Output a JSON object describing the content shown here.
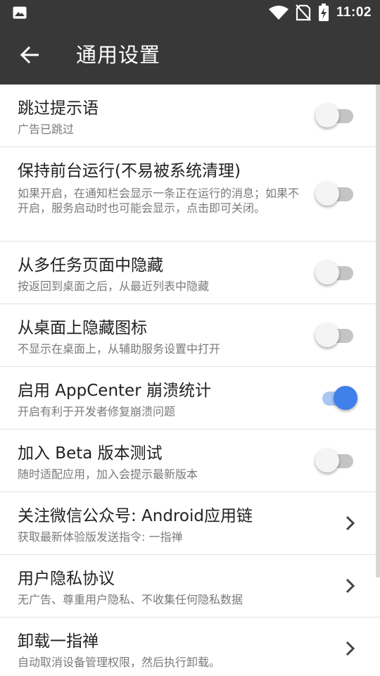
{
  "status_bar": {
    "time": "11:02",
    "icons": [
      "image-notification-icon",
      "wifi-icon",
      "no-sim-icon",
      "battery-charging-icon"
    ]
  },
  "app_bar": {
    "title": "通用设置",
    "back_icon": "arrow-left-icon"
  },
  "colors": {
    "app_bar_bg": "#383838",
    "switch_on": "#3f80ea",
    "switch_on_track": "#a9c6f4",
    "switch_off_track": "#c4c4c4"
  },
  "settings": [
    {
      "title": "跳过提示语",
      "subtitle": "广告已跳过",
      "control": "switch",
      "on": false
    },
    {
      "title": "保持前台运行(不易被系统清理)",
      "subtitle": "如果开启，在通知栏会显示一条正在运行的消息；如果不开启，服务启动时也可能会显示，点击即可关闭。",
      "control": "switch",
      "on": false
    },
    {
      "title": "从多任务页面中隐藏",
      "subtitle": "按返回到桌面之后，从最近列表中隐藏",
      "control": "switch",
      "on": false
    },
    {
      "title": "从桌面上隐藏图标",
      "subtitle": "不显示在桌面上，从辅助服务设置中打开",
      "control": "switch",
      "on": false
    },
    {
      "title": "启用 AppCenter 崩溃统计",
      "subtitle": "开启有利于开发者修复崩溃问题",
      "control": "switch",
      "on": true
    },
    {
      "title": "加入 Beta 版本测试",
      "subtitle": "随时适配应用，加入会提示最新版本",
      "control": "switch",
      "on": false
    },
    {
      "title": "关注微信公众号: Android应用链",
      "subtitle": "获取最新体验版发送指令: 一指禅",
      "control": "chevron"
    },
    {
      "title": "用户隐私协议",
      "subtitle": "无广告、尊重用户隐私、不收集任何隐私数据",
      "control": "chevron"
    },
    {
      "title": "卸载一指禅",
      "subtitle": "自动取消设备管理权限，然后执行卸载。",
      "control": "chevron"
    }
  ]
}
